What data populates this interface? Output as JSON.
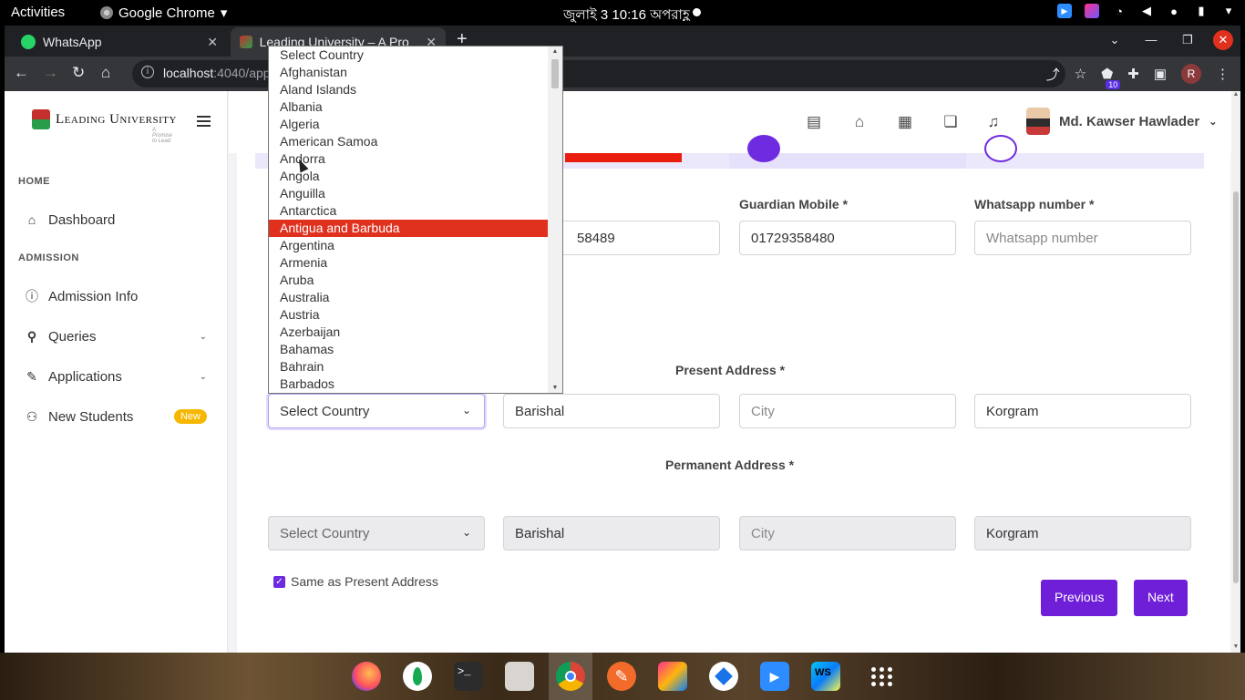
{
  "os": {
    "activities": "Activities",
    "app_name": "Google Chrome",
    "clock": "জুলাই 3  10:16 অপরাহ্ণ"
  },
  "browser": {
    "tabs": [
      {
        "title": "WhatsApp"
      },
      {
        "title": "Leading University – A Pro"
      }
    ],
    "url_host": "localhost",
    "url_path": ":4040/app",
    "extension_badge": "10",
    "profile_initial": "R"
  },
  "sidebar": {
    "logo_name": "Leading University",
    "logo_tagline": "A Promise to Lead",
    "sections": [
      {
        "heading": "HOME"
      },
      {
        "heading": "ADMISSION"
      }
    ],
    "items": [
      {
        "label": "Dashboard",
        "icon": "home-icon"
      },
      {
        "label": "Admission Info",
        "icon": "info-icon"
      },
      {
        "label": "Queries",
        "icon": "search-icon"
      },
      {
        "label": "Applications",
        "icon": "pencil-icon"
      },
      {
        "label": "New Students",
        "icon": "add-user-icon",
        "badge": "New"
      }
    ]
  },
  "header": {
    "user_name": "Md. Kawser Hawlader"
  },
  "form": {
    "mobile_partial": "58489",
    "guardian_mobile_label": "Guardian Mobile *",
    "guardian_mobile_value": "01729358480",
    "whatsapp_label": "Whatsapp number *",
    "whatsapp_placeholder": "Whatsapp number",
    "present_address_heading": "Present Address *",
    "present": {
      "country": "Select Country",
      "district": "Barishal",
      "city_placeholder": "City",
      "area": "Korgram"
    },
    "permanent_address_heading": "Permanent Address *",
    "same_as_present": "Same as Present Address",
    "permanent": {
      "country": "Select Country",
      "district": "Barishal",
      "city_placeholder": "City",
      "area": "Korgram"
    },
    "previous_button": "Previous",
    "next_button": "Next"
  },
  "country_dropdown": {
    "highlighted": "Antigua and Barbuda",
    "options": [
      "Select Country",
      "Afghanistan",
      "Aland Islands",
      "Albania",
      "Algeria",
      "American Samoa",
      "Andorra",
      "Angola",
      "Anguilla",
      "Antarctica",
      "Antigua and Barbuda",
      "Argentina",
      "Armenia",
      "Aruba",
      "Australia",
      "Austria",
      "Azerbaijan",
      "Bahamas",
      "Bahrain",
      "Barbados"
    ]
  },
  "colors": {
    "accent": "#6f1fd8",
    "highlight": "#e0301e",
    "badge": "#f5b700"
  }
}
